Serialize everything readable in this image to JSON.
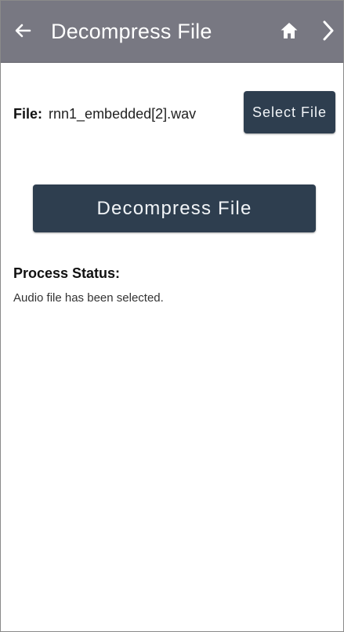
{
  "app_bar": {
    "title": "Decompress File",
    "icons": {
      "back": "arrow-back-icon",
      "home": "home-icon",
      "next": "chevron-right-icon"
    },
    "background_color": "#787882",
    "text_color": "#ffffff"
  },
  "file": {
    "label": "File:",
    "filename": "rnn1_embedded[2].wav"
  },
  "buttons": {
    "select_file": "Select File",
    "decompress_file": "Decompress File",
    "color": "#2e3e4f",
    "text_color": "#f1f4f7"
  },
  "status": {
    "heading": "Process Status:",
    "message": "Audio file has been selected."
  }
}
